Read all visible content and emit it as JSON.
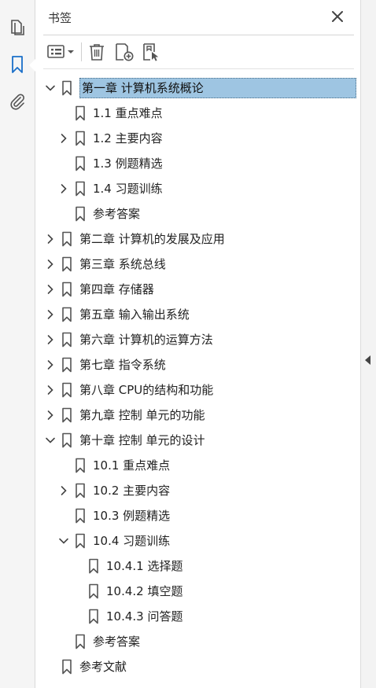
{
  "panel": {
    "title": "书签"
  },
  "colors": {
    "accent": "#1a6fc9",
    "selection": "#9ec5e2",
    "icon": "#555555"
  },
  "rail": {
    "items": [
      {
        "icon": "pages-icon"
      },
      {
        "icon": "bookmark-icon",
        "active": true
      },
      {
        "icon": "attachment-icon"
      }
    ]
  },
  "toolbar": {
    "items": [
      {
        "icon": "options-menu-icon"
      },
      {
        "icon": "delete-icon"
      },
      {
        "icon": "new-bookmark-icon"
      },
      {
        "icon": "find-bookmark-icon"
      }
    ]
  },
  "bookmarks": [
    {
      "label": "第一章 计算机系统概论",
      "level": 0,
      "chevron": "down",
      "selected": true
    },
    {
      "label": "1.1 重点难点",
      "level": 1,
      "chevron": "none"
    },
    {
      "label": "1.2 主要内容",
      "level": 1,
      "chevron": "right"
    },
    {
      "label": "1.3 例题精选",
      "level": 1,
      "chevron": "none"
    },
    {
      "label": "1.4 习题训练",
      "level": 1,
      "chevron": "right"
    },
    {
      "label": "参考答案",
      "level": 1,
      "chevron": "none"
    },
    {
      "label": "第二章 计算机的发展及应用",
      "level": 0,
      "chevron": "right"
    },
    {
      "label": "第三章 系统总线",
      "level": 0,
      "chevron": "right"
    },
    {
      "label": "第四章 存储器",
      "level": 0,
      "chevron": "right"
    },
    {
      "label": "第五章 输入输出系统",
      "level": 0,
      "chevron": "right"
    },
    {
      "label": "第六章 计算机的运算方法",
      "level": 0,
      "chevron": "right"
    },
    {
      "label": "第七章 指令系统",
      "level": 0,
      "chevron": "right"
    },
    {
      "label": "第八章 CPU的结构和功能",
      "level": 0,
      "chevron": "right"
    },
    {
      "label": "第九章 控制 单元的功能",
      "level": 0,
      "chevron": "right"
    },
    {
      "label": "第十章 控制 单元的设计",
      "level": 0,
      "chevron": "down"
    },
    {
      "label": "10.1 重点难点",
      "level": 1,
      "chevron": "none"
    },
    {
      "label": "10.2 主要内容",
      "level": 1,
      "chevron": "right"
    },
    {
      "label": "10.3 例题精选",
      "level": 1,
      "chevron": "none"
    },
    {
      "label": "10.4 习题训练",
      "level": 1,
      "chevron": "down"
    },
    {
      "label": "10.4.1 选择题",
      "level": 2,
      "chevron": "none"
    },
    {
      "label": "10.4.2 填空题",
      "level": 2,
      "chevron": "none"
    },
    {
      "label": "10.4.3 问答题",
      "level": 2,
      "chevron": "none"
    },
    {
      "label": "参考答案",
      "level": 1,
      "chevron": "none"
    },
    {
      "label": "参考文献",
      "level": 0,
      "chevron": "none"
    }
  ]
}
